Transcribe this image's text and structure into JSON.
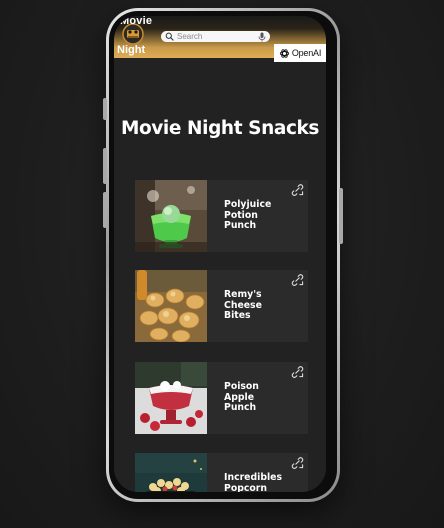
{
  "header": {
    "brand_top": "Movie",
    "brand_bottom": "Night",
    "search_placeholder": "Search",
    "openai_label": "OpenAI"
  },
  "page": {
    "title": "Movie Night Snacks"
  },
  "snacks": [
    {
      "title": "Polyjuice Potion Punch"
    },
    {
      "title": "Remy's Cheese Bites"
    },
    {
      "title": "Poison Apple Punch"
    },
    {
      "title": "Incredibles Popcorn"
    }
  ],
  "colors": {
    "screen_bg": "#222222",
    "card_bg": "#2b2b2b",
    "header_gold": "#e0ad55",
    "text": "#ffffff"
  },
  "icons": {
    "search": "search-icon",
    "mic": "microphone-icon",
    "openai": "openai-logo-icon",
    "share": "share-icon"
  }
}
